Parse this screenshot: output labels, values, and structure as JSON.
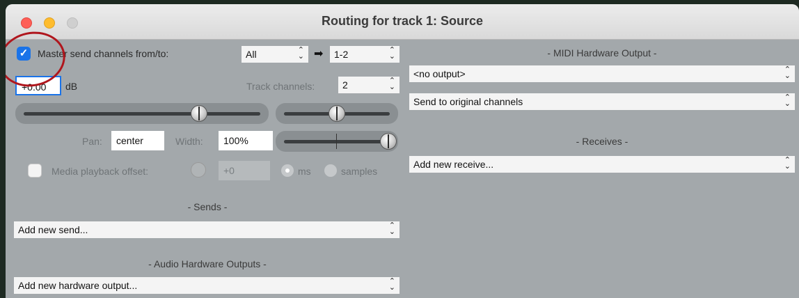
{
  "window": {
    "title": "Routing for track 1: Source"
  },
  "left": {
    "master_send": {
      "checked": true,
      "label": "Master send channels from/to:",
      "from": "All",
      "arrow": "➡",
      "to": "1-2"
    },
    "volume": {
      "value": "+0.00",
      "unit": "dB"
    },
    "track_channels": {
      "label": "Track channels:",
      "value": "2"
    },
    "pan": {
      "label": "Pan:",
      "value": "center"
    },
    "width": {
      "label": "Width:",
      "value": "100%"
    },
    "media_offset": {
      "checked": false,
      "label": "Media playback offset:",
      "value": "+0",
      "ms_label": "ms",
      "samples_label": "samples"
    },
    "sends": {
      "header": "- Sends -",
      "dropdown": "Add new send..."
    },
    "hw_outputs": {
      "header": "- Audio Hardware Outputs -",
      "dropdown": "Add new hardware output..."
    }
  },
  "right": {
    "midi": {
      "header": "- MIDI Hardware Output -",
      "output": "<no output>",
      "channels": "Send to original channels"
    },
    "receives": {
      "header": "- Receives -",
      "dropdown": "Add new receive..."
    }
  },
  "icons": {
    "arrows": "⌃⌄",
    "check": "✓"
  }
}
